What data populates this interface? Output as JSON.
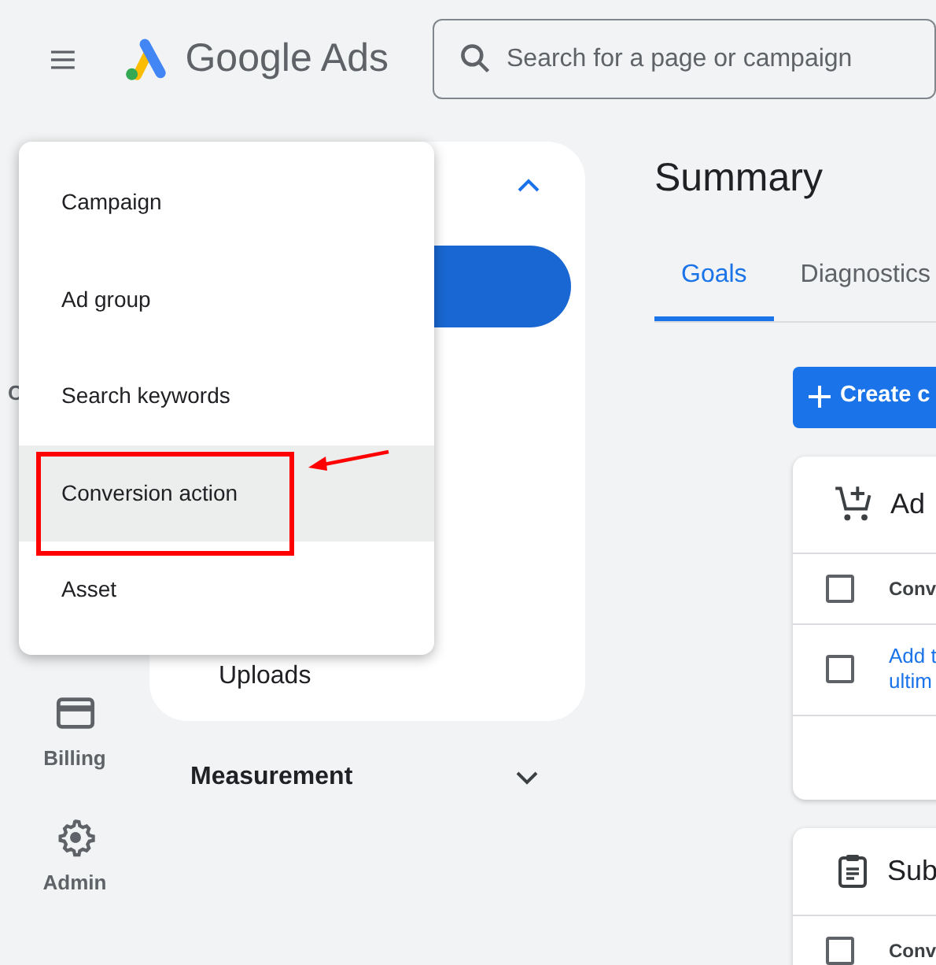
{
  "header": {
    "app_name": "Google Ads",
    "search": {
      "placeholder": "Search for a page or campaign"
    }
  },
  "rail": [
    {
      "kind": "cut",
      "label": "C"
    },
    {
      "kind": "billing",
      "label": "Billing"
    },
    {
      "kind": "admin",
      "label": "Admin"
    }
  ],
  "panel": {
    "expanded": true,
    "items": [
      {
        "kind": "pill",
        "selected": true
      },
      {
        "kind": "link",
        "label": "Uploads",
        "selected": false
      }
    ],
    "sections": [
      {
        "label": "Measurement",
        "expanded": false
      }
    ]
  },
  "menu": [
    {
      "label": "Campaign",
      "hovered": false
    },
    {
      "label": "Ad group",
      "hovered": false
    },
    {
      "label": "Search keywords",
      "hovered": false
    },
    {
      "label": "Conversion action",
      "hovered": true
    },
    {
      "label": "Asset",
      "hovered": false
    }
  ],
  "annotations": [
    {
      "kind": "box"
    },
    {
      "kind": "arrow"
    }
  ],
  "main": {
    "title": "Summary",
    "tabs": [
      {
        "label": "Goals",
        "selected": true
      },
      {
        "label": "Diagnostics",
        "selected": false
      }
    ],
    "create_button": "Create c",
    "cards": [
      {
        "kind": "cart",
        "title": "Ad",
        "rows": [
          {
            "kind": "plain",
            "lines": [
              "Conv"
            ],
            "checked": false
          },
          {
            "kind": "link",
            "lines": [
              "Add t",
              "ultim"
            ],
            "checked": false
          }
        ]
      },
      {
        "kind": "clipboard",
        "title": "Sub",
        "rows": [
          {
            "kind": "plain",
            "lines": [
              "Conv"
            ],
            "checked": false
          }
        ]
      }
    ]
  }
}
